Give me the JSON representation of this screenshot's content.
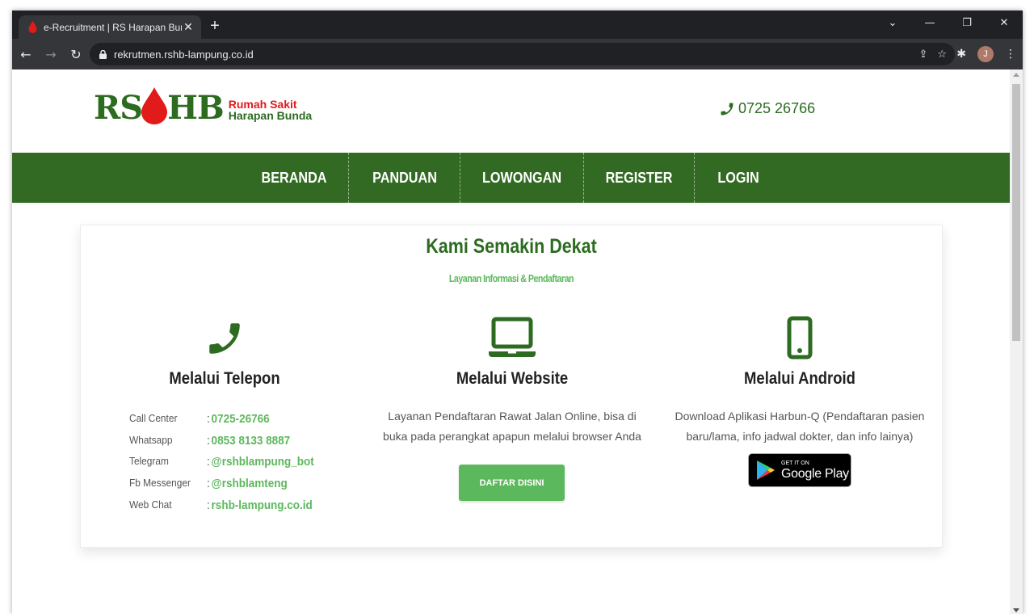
{
  "browser": {
    "tab_title": "e-Recruitment | RS Harapan Bunda",
    "tab_close": "✕",
    "new_tab": "+",
    "url": "rekrutmen.rshb-lampung.co.id",
    "avatar_initial": "J",
    "controls": {
      "dropdown": "⌄",
      "minimize": "—",
      "restore": "❐",
      "close": "✕"
    }
  },
  "header": {
    "logo_letters_left": "RS",
    "logo_letters_right": "HB",
    "logo_line1": "Rumah Sakit",
    "logo_line2": "Harapan Bunda",
    "phone": "0725 26766"
  },
  "nav": {
    "items": [
      "BERANDA",
      "PANDUAN",
      "LOWONGAN",
      "REGISTER",
      "LOGIN"
    ]
  },
  "section": {
    "title": "Kami Semakin Dekat",
    "subtitle": "Layanan Informasi & Pendaftaran"
  },
  "telepon": {
    "title": "Melalui Telepon",
    "contacts": [
      {
        "label": "Call Center",
        "value": "0725-26766"
      },
      {
        "label": "Whatsapp",
        "value": "0853 8133 8887"
      },
      {
        "label": "Telegram",
        "value": "@rshblampung_bot"
      },
      {
        "label": "Fb Messenger",
        "value": "@rshblamteng"
      },
      {
        "label": "Web Chat",
        "value": "rshb-lampung.co.id"
      }
    ],
    "separator": ":"
  },
  "website": {
    "title": "Melalui Website",
    "text": "Layanan Pendaftaran Rawat Jalan Online, bisa di buka pada perangkat apapun melalui browser Anda",
    "button": "DAFTAR DISINI"
  },
  "android": {
    "title": "Melalui Android",
    "text": "Download Aplikasi Harbun-Q (Pendaftaran pasien baru/lama, info jadwal dokter, dan info lainya)",
    "badge_small": "GET IT ON",
    "badge_big": "Google Play"
  },
  "colors": {
    "brand_green": "#336a23",
    "accent_green": "#5cb85c",
    "logo_red": "#e11a1a"
  }
}
